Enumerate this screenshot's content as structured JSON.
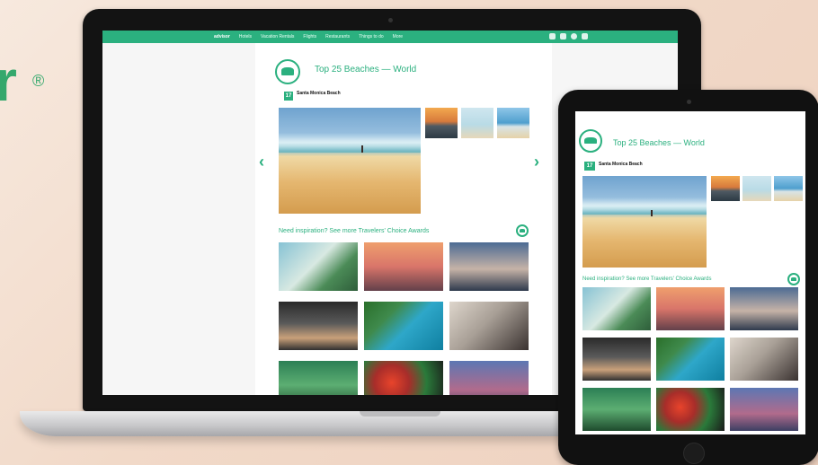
{
  "brand": {
    "letter": "r",
    "registered": "®"
  },
  "site": {
    "nav": [
      "advisor",
      "Hotels",
      "Vacation Rentals",
      "Flights",
      "Restaurants",
      "Things to do",
      "More"
    ],
    "sublinks": "",
    "page_title": "Top 25 Beaches — World",
    "tabs": [
      "",
      "",
      ""
    ],
    "view_all": "",
    "rank": "17",
    "beach_name": "Santa Monica Beach",
    "beach_location": "",
    "info_lines": [
      "",
      "",
      "",
      "",
      ""
    ],
    "inspiration": "Need inspiration? See more Travelers' Choice Awards",
    "tiles": [
      "",
      "",
      "",
      "",
      "",
      "",
      "",
      "",
      ""
    ]
  },
  "tablet_site": {
    "page_title": "Top 25 Beaches — World",
    "rank": "17",
    "beach_name": "Santa Monica Beach",
    "inspiration": "Need inspiration? See more Travelers' Choice Awards"
  },
  "colors": {
    "accent": "#2bb07f",
    "brand_green": "#34a86c"
  }
}
